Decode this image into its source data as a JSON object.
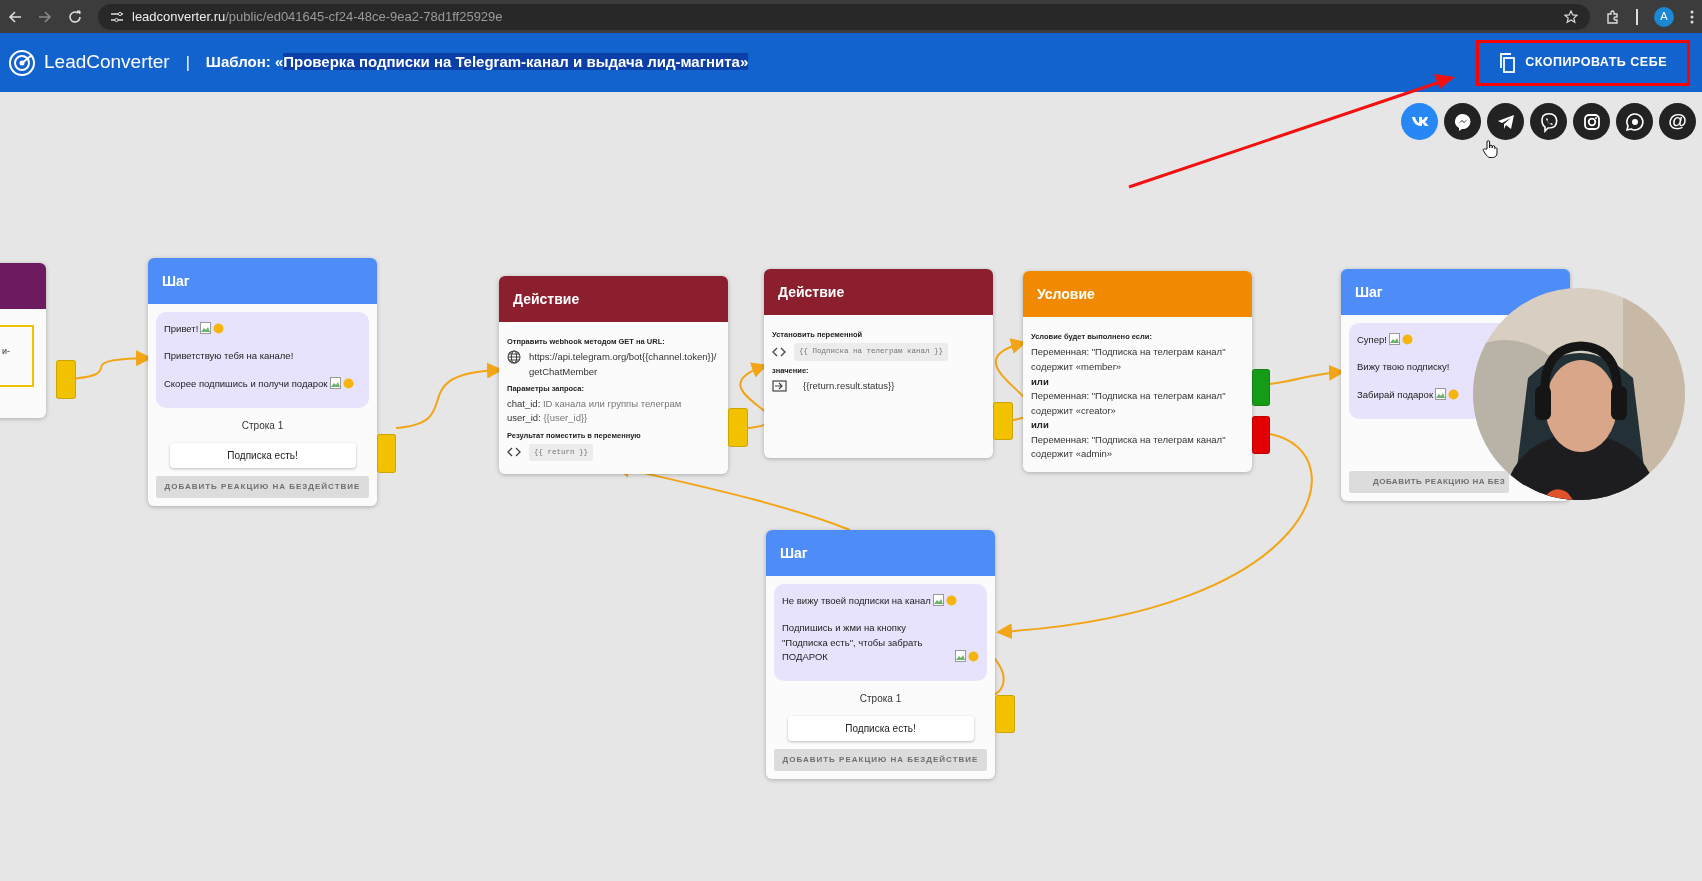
{
  "browser": {
    "url_host": "leadconverter.ru",
    "url_path": "/public/ed041645-cf24-48ce-9ea2-78d1ff25929e",
    "profile": "A"
  },
  "header": {
    "brand": "LeadConverter",
    "separator": "|",
    "title_prefix": "Шаблон: «",
    "title_highlighted": "Проверка подписки на Telegram-канал и выдача лид-магнита»",
    "copy_button": "СКОПИРОВАТЬ СЕБЕ"
  },
  "share": [
    {
      "kind": "vk",
      "color": "#2787f5"
    },
    {
      "kind": "messenger",
      "color": "#222222"
    },
    {
      "kind": "telegram",
      "color": "#222222"
    },
    {
      "kind": "viber",
      "color": "#222222"
    },
    {
      "kind": "instagram",
      "color": "#222222"
    },
    {
      "kind": "whatsapp",
      "color": "#222222"
    },
    {
      "kind": "email",
      "color": "#222222",
      "label": "@"
    }
  ],
  "nodes": [
    {
      "kind": "start",
      "fragment": "и-"
    },
    {
      "kind": "step",
      "title": "Шаг",
      "messages": [
        {
          "text": "Привет!",
          "image": true
        },
        {
          "text": "Приветствую тебя на канале!",
          "image": false
        },
        {
          "text": "Скорее подпишись и получи подарок",
          "image": true
        }
      ],
      "row": "Строка 1",
      "buttons": [
        "Подписка есть!"
      ],
      "idle": "ДОБАВИТЬ РЕАКЦИЮ НА БЕЗДЕЙСТВИЕ"
    },
    {
      "kind": "action",
      "title": "Действие",
      "items": [
        {
          "kind": "label",
          "text": "Отправить webhook методом GET на URL:"
        },
        {
          "kind": "url",
          "text": "https://api.telegram.org/bot{{channel.token}}/getChatMember"
        },
        {
          "kind": "label",
          "text": "Параметры запроса:"
        },
        {
          "kind": "param",
          "key": "chat_id:",
          "value": "ID канала или группы телеграм"
        },
        {
          "kind": "param",
          "key": "user_id:",
          "value": "{{user_id}}"
        },
        {
          "kind": "label",
          "text": "Результат поместить в переменную"
        },
        {
          "kind": "variable",
          "text": "{{ return }}"
        }
      ]
    },
    {
      "kind": "action",
      "title": "Действие",
      "items": [
        {
          "kind": "label",
          "text": "Установить переменной"
        },
        {
          "kind": "variable",
          "text": "{{ Подписка на телеграм канал }}"
        },
        {
          "kind": "label",
          "text": "значение:"
        },
        {
          "kind": "value",
          "text": "{{return.result.status}}"
        }
      ]
    },
    {
      "kind": "condition",
      "title": "Условие",
      "items": [
        {
          "kind": "label",
          "text": "Условие будет выполнено если:"
        },
        {
          "kind": "text",
          "text": "Переменная: \"Подписка на телеграм канал\" содержит «member»"
        },
        {
          "kind": "or",
          "text": "или"
        },
        {
          "kind": "text",
          "text": "Переменная: \"Подписка на телеграм канал\" содержит «creator»"
        },
        {
          "kind": "or",
          "text": "или"
        },
        {
          "kind": "text",
          "text": "Переменная: \"Подписка на телеграм канал\" содержит «admin»"
        }
      ],
      "outputs": [
        {
          "color": "#169b16"
        },
        {
          "color": "#e30000"
        }
      ]
    },
    {
      "kind": "step",
      "title": "Шаг",
      "messages": [
        {
          "text": "Супер!",
          "image": true
        },
        {
          "text": "Вижу твою подписку!",
          "image": false
        },
        {
          "text": "Забирай подарок",
          "image": true
        }
      ],
      "idle": "ДОБАВИТЬ РЕАКЦИЮ НА БЕЗ"
    },
    {
      "kind": "step",
      "title": "Шаг",
      "messages": [
        {
          "text": "Не вижу твоей подписки на канал",
          "image": true
        },
        {
          "text": "Подпишись и жми на кнопку \"Подписка есть\", чтобы забрать ПОДАРОК",
          "image": true
        }
      ],
      "row": "Строка 1",
      "buttons": [
        "Подписка есть!"
      ],
      "idle": "ДОБАВИТЬ РЕАКЦИЮ НА БЕЗДЕЙСТВИЕ"
    }
  ]
}
